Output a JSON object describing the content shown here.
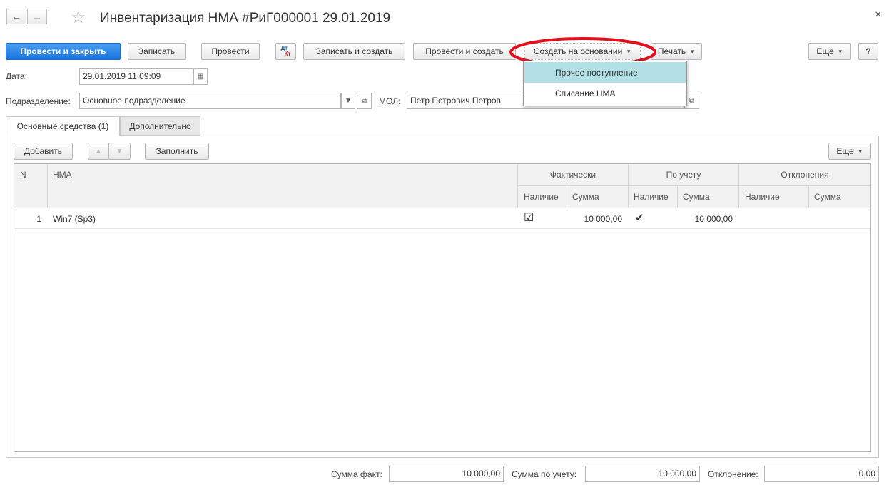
{
  "window": {
    "title": "Инвентаризация НМА #РиГ000001 29.01.2019",
    "close": "×",
    "back": "←",
    "forward": "→",
    "star": "☆"
  },
  "toolbar": {
    "post_close": "Провести и закрыть",
    "save": "Записать",
    "post": "Провести",
    "dtkt_top": "Дт",
    "dtkt_bottom": "Кт",
    "save_create": "Записать и создать",
    "post_create": "Провести и создать",
    "create_based": "Создать на основании",
    "print": "Печать",
    "more": "Еще",
    "help": "?"
  },
  "dropdown": {
    "items": [
      "Прочее поступление",
      "Списание НМА"
    ]
  },
  "form": {
    "date_label": "Дата:",
    "date_value": "29.01.2019 11:09:09",
    "division_label": "Подразделение:",
    "division_value": "Основное подразделение",
    "mol_label": "МОЛ:",
    "mol_value": "Петр Петрович Петров"
  },
  "tabs": [
    {
      "label": "Основные средства (1)"
    },
    {
      "label": "Дополнительно"
    }
  ],
  "table_toolbar": {
    "add": "Добавить",
    "fill": "Заполнить",
    "more": "Еще",
    "up": "▲",
    "down": "▼"
  },
  "table": {
    "headers": {
      "n": "N",
      "nma": "НМА",
      "actual": "Фактически",
      "accounting": "По учету",
      "deviations": "Отклонения"
    },
    "subheaders": {
      "presence": "Наличие",
      "sum": "Сумма"
    },
    "rows": [
      {
        "n": "1",
        "nma": "Win7 (Sp3)",
        "actual_presence": "☑",
        "actual_sum": "10 000,00",
        "acc_presence": "✔",
        "acc_sum": "10 000,00"
      }
    ]
  },
  "footer": {
    "sum_fact_label": "Сумма факт:",
    "sum_fact_value": "10 000,00",
    "sum_acc_label": "Сумма по учету:",
    "sum_acc_value": "10 000,00",
    "deviation_label": "Отклонение:",
    "deviation_value": "0,00"
  },
  "colors": {
    "primary": "#1976e0",
    "highlight_ring": "#e3101c",
    "menu_hover": "#b3e0e6"
  }
}
